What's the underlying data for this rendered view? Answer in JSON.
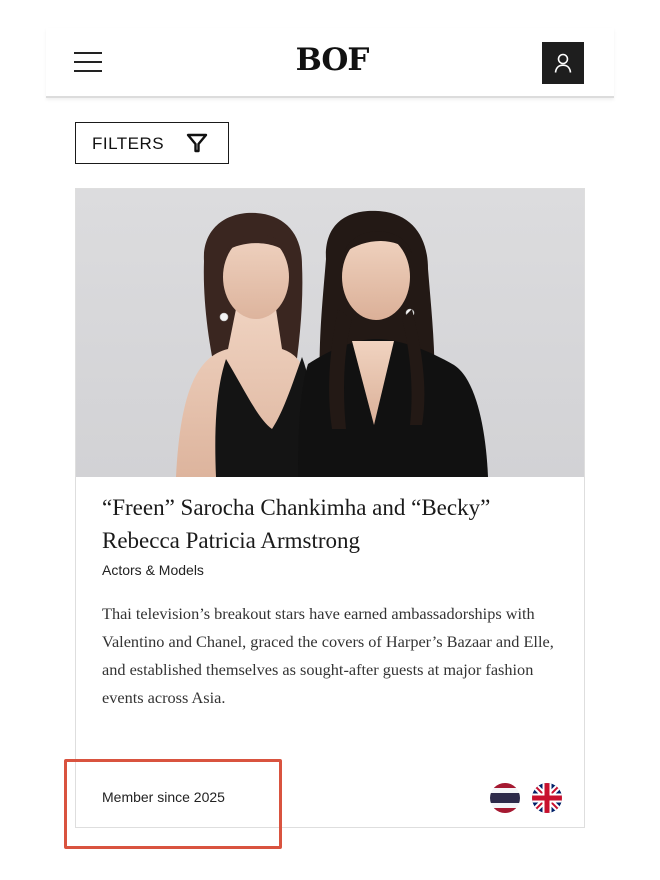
{
  "header": {
    "logo_text": "BOF",
    "menu_icon": "hamburger-menu-icon",
    "account_icon": "user-icon"
  },
  "filters": {
    "label": "FILTERS",
    "icon": "funnel-icon"
  },
  "profile_card": {
    "image_alt": "Portrait of two women in black outfits against a light grey background",
    "title": "“Freen” Sarocha Chankimha and “Becky” Rebecca Patricia Armstrong",
    "category": "Actors & Models",
    "description": "Thai television’s breakout stars have earned ambassadorships with Valentino and Chanel, graced the covers of Harper’s Bazaar and Elle, and established themselves as sought-after guests at major fashion events across Asia.",
    "member_since": "Member since 2025",
    "flags": [
      "thailand-flag-icon",
      "united-kingdom-flag-icon"
    ]
  },
  "colors": {
    "account_button_bg": "#1e1e1e",
    "highlight_outline": "#d9533f",
    "photo_background": "#d7d7da"
  }
}
